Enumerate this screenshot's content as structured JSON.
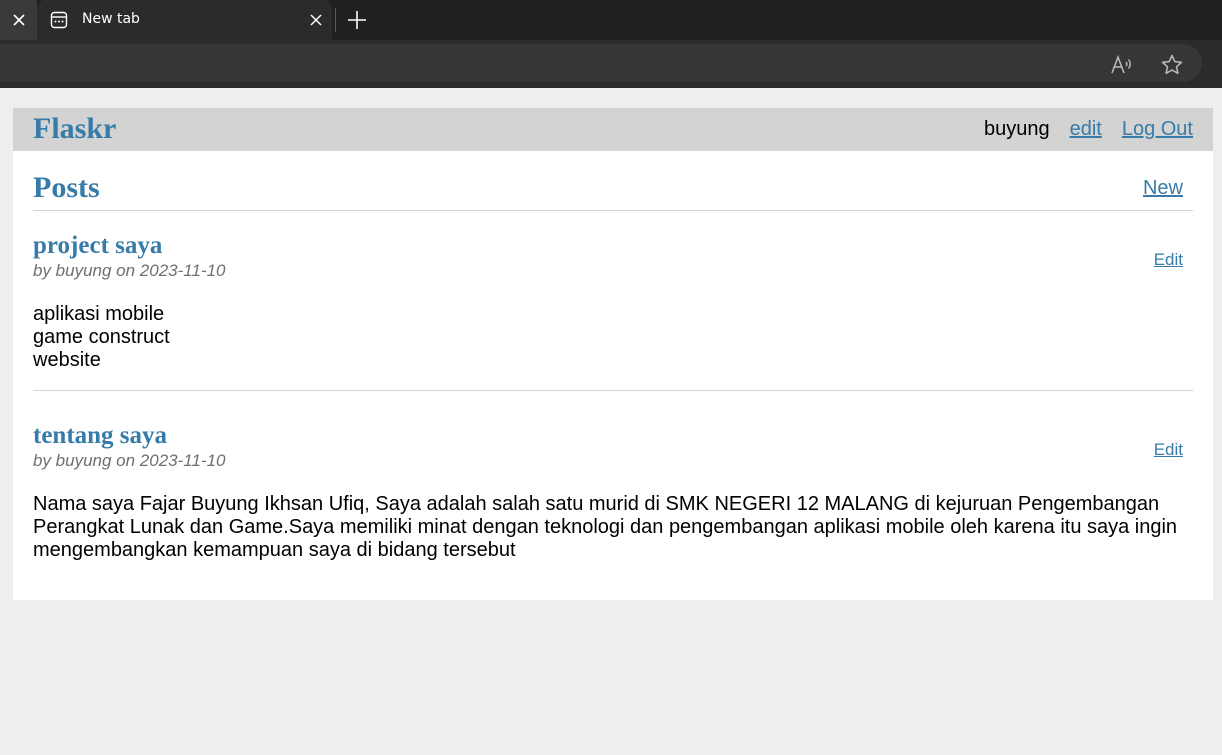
{
  "browser": {
    "tab_title": "New tab"
  },
  "app": {
    "brand": "Flaskr",
    "user": "buyung",
    "edit_link": "edit",
    "logout_link": "Log Out"
  },
  "header": {
    "title": "Posts",
    "new_link": "New"
  },
  "posts": [
    {
      "title": "project saya",
      "about": "by buyung on 2023-11-10",
      "edit": "Edit",
      "body": "aplikasi mobile\ngame construct\nwebsite"
    },
    {
      "title": "tentang saya",
      "about": "by buyung on 2023-11-10",
      "edit": "Edit",
      "body": "Nama saya Fajar Buyung Ikhsan Ufiq, Saya adalah salah satu murid di SMK NEGERI 12 MALANG di kejuruan Pengembangan Perangkat Lunak dan Game.Saya memiliki minat dengan teknologi dan pengembangan aplikasi mobile oleh karena itu saya ingin mengembangkan kemampuan saya di bidang tersebut"
    }
  ],
  "colors": {
    "accent": "#377ba8",
    "nav_bg": "#d3d3d3"
  }
}
